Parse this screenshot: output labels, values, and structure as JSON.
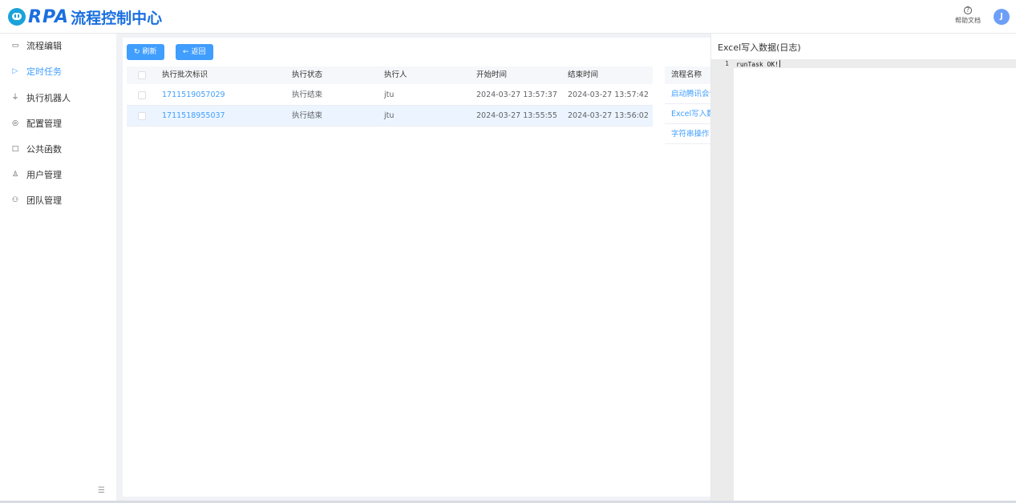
{
  "app": {
    "logo_rpa": "RPA",
    "logo_title": "流程控制中心"
  },
  "header": {
    "help_label": "帮助文档",
    "avatar_initial": "J"
  },
  "sidebar": {
    "items": [
      {
        "label": "流程编辑",
        "icon": "monitor-icon"
      },
      {
        "label": "定时任务",
        "icon": "play-icon",
        "active": true
      },
      {
        "label": "执行机器人",
        "icon": "robot-icon"
      },
      {
        "label": "配置管理",
        "icon": "settings-icon"
      },
      {
        "label": "公共函数",
        "icon": "function-icon"
      },
      {
        "label": "用户管理",
        "icon": "user-icon"
      },
      {
        "label": "团队管理",
        "icon": "team-icon"
      }
    ],
    "collapse_icon": "collapse-menu-icon"
  },
  "toolbar": {
    "refresh_label": "刷新",
    "back_label": "返回"
  },
  "table": {
    "columns": [
      "执行批次标识",
      "执行状态",
      "执行人",
      "开始时间",
      "结束时间"
    ],
    "rows": [
      {
        "batch_id": "1711519057029",
        "status": "执行结束",
        "executor": "jtu",
        "start": "2024-03-27 13:57:37",
        "end": "2024-03-27 13:57:42"
      },
      {
        "batch_id": "1711518955037",
        "status": "执行结束",
        "executor": "jtu",
        "start": "2024-03-27 13:55:55",
        "end": "2024-03-27 13:56:02"
      }
    ]
  },
  "flow_names": {
    "header": "流程名称",
    "items": [
      "启动腾讯会议",
      "Excel写入数据",
      "字符串操作"
    ]
  },
  "log_panel": {
    "title": "Excel写入数据(日志)",
    "line_number": "1",
    "line_text": "runTask OK!"
  },
  "colors": {
    "accent": "#409eff",
    "brand": "#1a6fe0"
  }
}
